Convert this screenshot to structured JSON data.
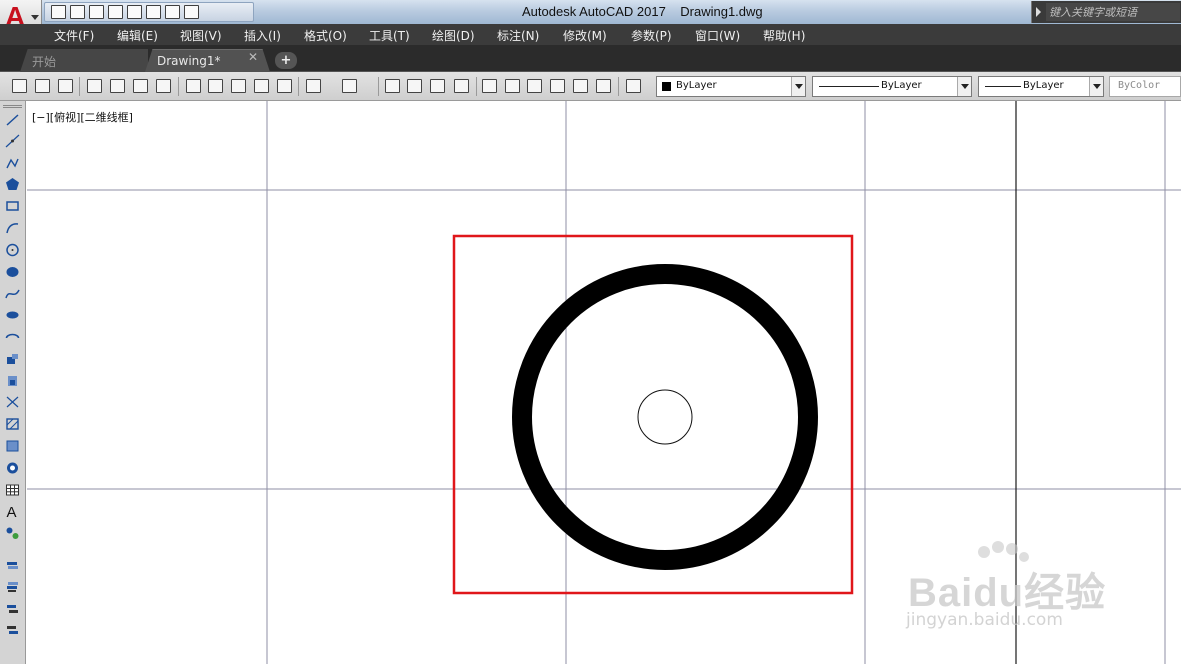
{
  "app": {
    "title": "Autodesk AutoCAD 2017    Drawing1.dwg",
    "logo_letter": "A",
    "search_placeholder": "键入关键字或短语"
  },
  "menu": {
    "items": [
      "文件(F)",
      "编辑(E)",
      "视图(V)",
      "插入(I)",
      "格式(O)",
      "工具(T)",
      "绘图(D)",
      "标注(N)",
      "修改(M)",
      "参数(P)",
      "窗口(W)",
      "帮助(H)"
    ]
  },
  "tabs": {
    "start": "开始",
    "drawing": "Drawing1*",
    "close_glyph": "✕",
    "add_glyph": "+"
  },
  "properties": {
    "color": "ByLayer",
    "linetype": "ByLayer",
    "lineweight": "ByLayer",
    "plotstyle": "ByColor"
  },
  "viewport": {
    "label": "[−][俯视][二维线框]"
  },
  "left_tools": [
    "line-icon",
    "construction-line-icon",
    "polyline-icon",
    "polygon-icon",
    "rectangle-icon",
    "arc-icon",
    "circle-icon",
    "revision-cloud-icon",
    "spline-icon",
    "ellipse-icon",
    "ellipse-arc-icon",
    "insert-block-icon",
    "make-block-icon",
    "point-icon",
    "hatch-icon",
    "gradient-icon",
    "region-icon",
    "table-icon",
    "text-icon",
    "add-selected-icon",
    "layer-icon",
    "layer-previous-icon",
    "layer-match-icon",
    "layer-isolate-icon"
  ],
  "toolbar_icons": [
    "new-icon",
    "open-icon",
    "save-icon",
    "plot-icon",
    "plot-preview-icon",
    "publish-icon",
    "3d-print-icon",
    "cut-icon",
    "copy-icon",
    "paste-icon",
    "match-properties-icon",
    "block-editor-icon",
    "undo-icon",
    "redo-icon",
    "pan-icon",
    "zoom-realtime-icon",
    "zoom-window-icon",
    "zoom-previous-icon",
    "properties-icon",
    "design-center-icon",
    "tool-palettes-icon",
    "sheet-set-icon",
    "markup-icon",
    "quickcalc-icon",
    "help-icon"
  ],
  "colors": {
    "highlight_box": "#e0161a",
    "ring": "#000000",
    "grid_line": "#8f8fa5",
    "ucs_line": "#1a1a1a"
  },
  "watermark": {
    "brand": "Baidu经验",
    "url": "jingyan.baidu.com"
  }
}
